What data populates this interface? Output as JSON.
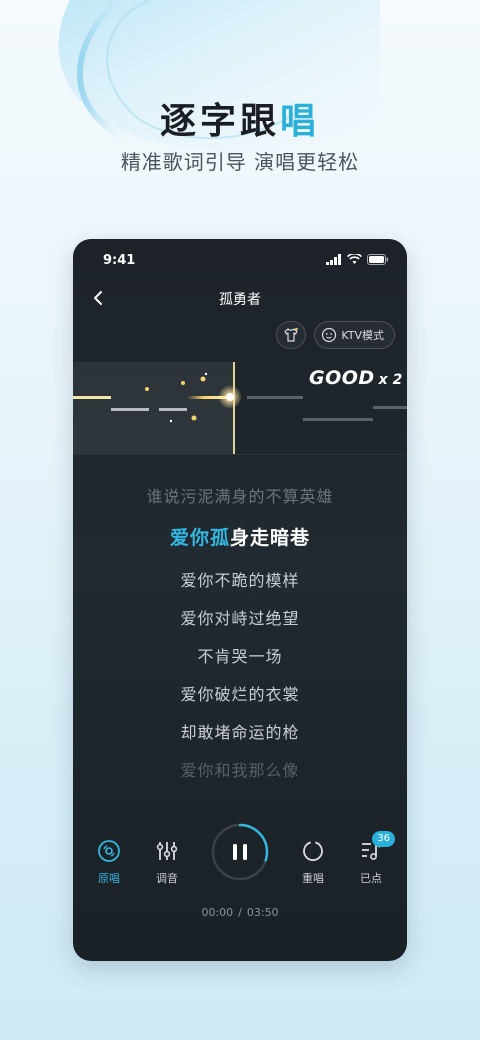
{
  "hero": {
    "title_prefix": "逐字跟",
    "title_highlight": "唱",
    "subtitle": "精准歌词引导 演唱更轻松"
  },
  "status_bar": {
    "time": "9:41"
  },
  "player": {
    "song_title": "孤勇者",
    "ktv_label": "KTV模式",
    "score": {
      "word": "GOOD",
      "multiplier": "x 2"
    },
    "lyrics": {
      "previous": "谁说污泥满身的不算英雄",
      "current_sung": "爱你孤",
      "current_rest": "身走暗巷",
      "upcoming": [
        "爱你不跪的模样",
        "爱你对峙过绝望",
        "不肯哭一场",
        "爱你破烂的衣裳",
        "却敢堵命运的枪",
        "爱你和我那么像"
      ]
    },
    "tools": {
      "original": "原唱",
      "tuning": "调音",
      "restart": "重唱",
      "queued": "已点",
      "queued_count": "36"
    },
    "progress": {
      "elapsed": "00:00",
      "separator": "/",
      "total": "03:50",
      "fraction": 0.3
    }
  },
  "colors": {
    "accent": "#33b6e0",
    "phone_bg": "#1c2228"
  }
}
